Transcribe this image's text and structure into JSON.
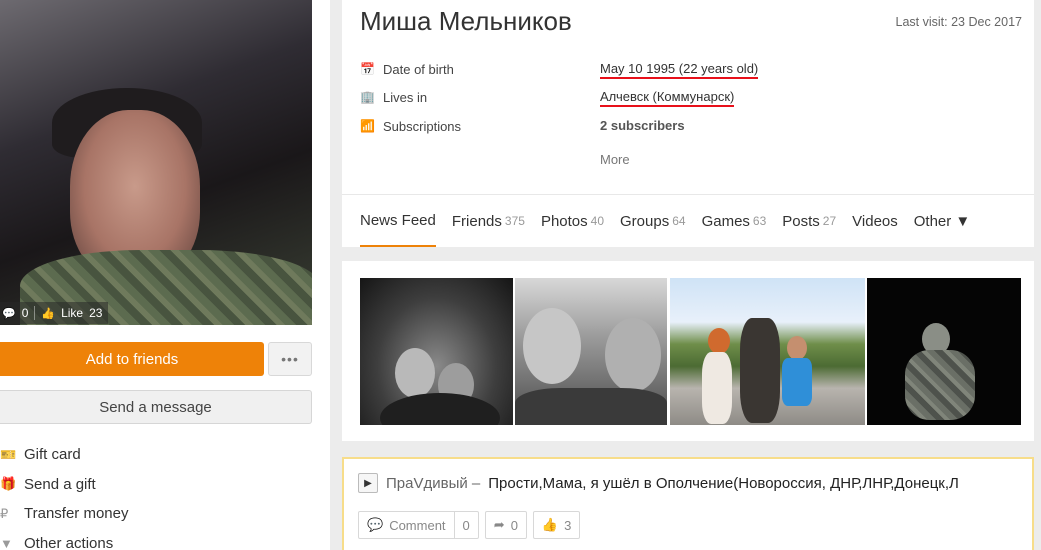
{
  "avatar": {
    "comments_count": "0",
    "like_label": "Like",
    "like_count": "23"
  },
  "buttons": {
    "add_friends": "Add to friends",
    "more": "•••",
    "send_message": "Send a message"
  },
  "actions": [
    {
      "label": "Gift card",
      "icon": "gift-card-icon"
    },
    {
      "label": "Send a gift",
      "icon": "gift-icon"
    },
    {
      "label": "Transfer money",
      "icon": "ruble-icon"
    },
    {
      "label": "Other actions",
      "icon": "chevron-down-icon"
    }
  ],
  "profile": {
    "name": "Миша Мельников",
    "last_visit": "Last visit: 23 Dec 2017",
    "rows": [
      {
        "label": "Date of birth",
        "value": "May 10 1995 (22 years old)"
      },
      {
        "label": "Lives in",
        "value": "Алчевск (Коммунарск)"
      },
      {
        "label": "Subscriptions",
        "value": "2 subscribers"
      }
    ],
    "more": "More"
  },
  "tabs": [
    {
      "label": "News Feed",
      "count": ""
    },
    {
      "label": "Friends",
      "count": "375"
    },
    {
      "label": "Photos",
      "count": "40"
    },
    {
      "label": "Groups",
      "count": "64"
    },
    {
      "label": "Games",
      "count": "63"
    },
    {
      "label": "Posts",
      "count": "27"
    },
    {
      "label": "Videos",
      "count": ""
    },
    {
      "label": "Other ▼",
      "count": ""
    }
  ],
  "post": {
    "artist": "ПраVдивый –",
    "song": "Прости,Мама, я ушёл в Ополчение(Новороссия, ДНР,ЛНР,Донецк,Л",
    "comment_label": "Comment",
    "comment_count": "0",
    "share_count": "0",
    "like_count": "3"
  },
  "colors": {
    "accent": "#ee8208",
    "underline": "#e8101a",
    "post_border": "#f7dd8a"
  }
}
